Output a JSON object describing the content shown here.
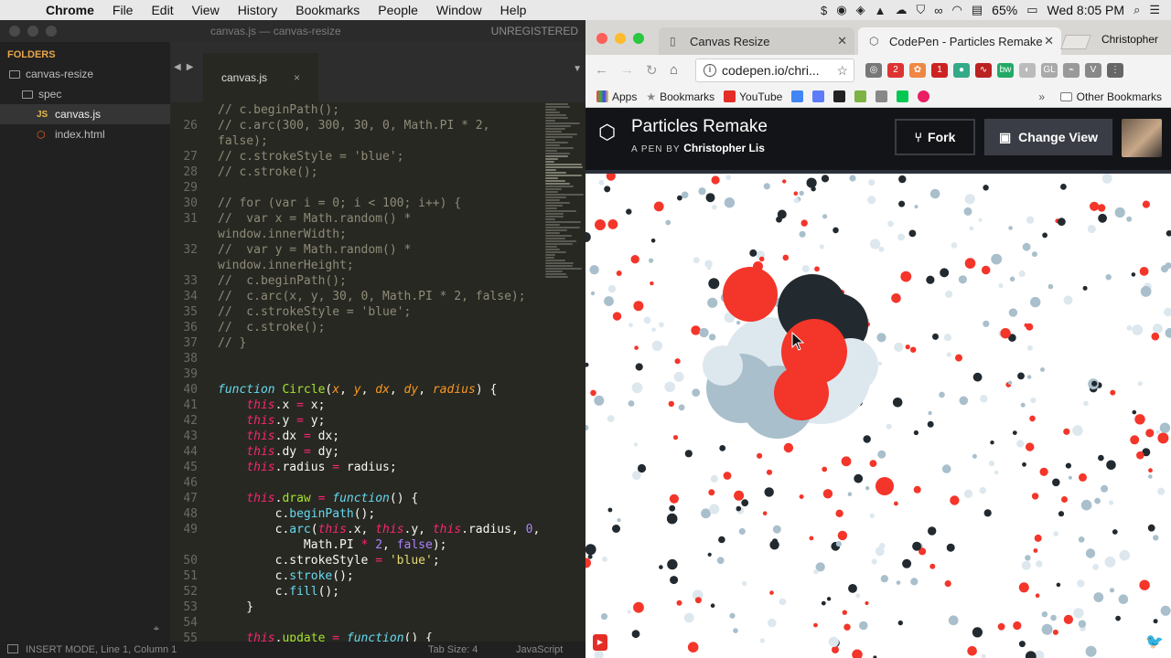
{
  "menubar": {
    "app": "Chrome",
    "items": [
      "File",
      "Edit",
      "View",
      "History",
      "Bookmarks",
      "People",
      "Window",
      "Help"
    ],
    "battery": "65%",
    "clock": "Wed 8:05 PM"
  },
  "editor": {
    "title": "canvas.js — canvas-resize",
    "unregistered": "UNREGISTERED",
    "folders_label": "FOLDERS",
    "tree": [
      {
        "name": "canvas-resize",
        "type": "folder-open"
      },
      {
        "name": "spec",
        "type": "folder"
      },
      {
        "name": "canvas.js",
        "type": "js",
        "selected": true
      },
      {
        "name": "index.html",
        "type": "html"
      }
    ],
    "tab": "canvas.js",
    "status": {
      "mode": "INSERT MODE, Line 1, Column 1",
      "tab_size": "Tab Size: 4",
      "language": "JavaScript"
    }
  },
  "code_lines": [
    {
      "n": "",
      "t": "// c.beginPath();",
      "k": "com"
    },
    {
      "n": "26",
      "t": "// c.arc(300, 300, 30, 0, Math.PI * 2,",
      "k": "com"
    },
    {
      "n": "",
      "t": "false);",
      "k": "com"
    },
    {
      "n": "27",
      "t": "// c.strokeStyle = 'blue';",
      "k": "com"
    },
    {
      "n": "28",
      "t": "// c.stroke();",
      "k": "com"
    },
    {
      "n": "29",
      "t": "",
      "k": "com"
    },
    {
      "n": "30",
      "t": "// for (var i = 0; i < 100; i++) {",
      "k": "com"
    },
    {
      "n": "31",
      "t": "//  var x = Math.random() *",
      "k": "com"
    },
    {
      "n": "",
      "t": "window.innerWidth;",
      "k": "com"
    },
    {
      "n": "32",
      "t": "//  var y = Math.random() *",
      "k": "com"
    },
    {
      "n": "",
      "t": "window.innerHeight;",
      "k": "com"
    },
    {
      "n": "33",
      "t": "//  c.beginPath();",
      "k": "com"
    },
    {
      "n": "34",
      "t": "//  c.arc(x, y, 30, 0, Math.PI * 2, false);",
      "k": "com"
    },
    {
      "n": "35",
      "t": "//  c.strokeStyle = 'blue';",
      "k": "com"
    },
    {
      "n": "36",
      "t": "//  c.stroke();",
      "k": "com"
    },
    {
      "n": "37",
      "t": "// }",
      "k": "com"
    },
    {
      "n": "38",
      "t": "",
      "k": "plain"
    },
    {
      "n": "39",
      "t": "",
      "k": "plain"
    },
    {
      "n": "40",
      "t": "function Circle(x, y, dx, dy, radius) {",
      "k": "fndecl"
    },
    {
      "n": "41",
      "t": "    this.x = x;",
      "k": "assign"
    },
    {
      "n": "42",
      "t": "    this.y = y;",
      "k": "assign"
    },
    {
      "n": "43",
      "t": "    this.dx = dx;",
      "k": "assign"
    },
    {
      "n": "44",
      "t": "    this.dy = dy;",
      "k": "assign"
    },
    {
      "n": "45",
      "t": "    this.radius = radius;",
      "k": "assign"
    },
    {
      "n": "46",
      "t": "",
      "k": "plain"
    },
    {
      "n": "47",
      "t": "    this.draw = function() {",
      "k": "drawfn"
    },
    {
      "n": "48",
      "t": "        c.beginPath();",
      "k": "call"
    },
    {
      "n": "49",
      "t": "        c.arc(this.x, this.y, this.radius, 0,",
      "k": "arc"
    },
    {
      "n": "",
      "t": "            Math.PI * 2, false);",
      "k": "arc2"
    },
    {
      "n": "50",
      "t": "        c.strokeStyle = 'blue';",
      "k": "stroke"
    },
    {
      "n": "51",
      "t": "        c.stroke();",
      "k": "call"
    },
    {
      "n": "52",
      "t": "        c.fill();",
      "k": "call"
    },
    {
      "n": "53",
      "t": "    }",
      "k": "plain"
    },
    {
      "n": "54",
      "t": "",
      "k": "plain"
    },
    {
      "n": "55",
      "t": "    this.update = function() {",
      "k": "drawfn"
    }
  ],
  "browser": {
    "user": "Christopher",
    "tabs": [
      {
        "title": "Canvas Resize",
        "active": false
      },
      {
        "title": "CodePen - Particles Remake",
        "active": true
      }
    ],
    "url": "codepen.io/chri...",
    "bookmarks": [
      "Apps",
      "Bookmarks",
      "YouTube"
    ],
    "other_bookmarks": "Other Bookmarks"
  },
  "codepen": {
    "title": "Particles Remake",
    "by_prefix": "A PEN BY",
    "author": "Christopher Lis",
    "fork_label": "Fork",
    "change_view_label": "Change View"
  },
  "colors": {
    "red": "#f4352a",
    "dark": "#222a30",
    "light_blue": "#a9bfcc",
    "pale": "#dde8ee"
  }
}
